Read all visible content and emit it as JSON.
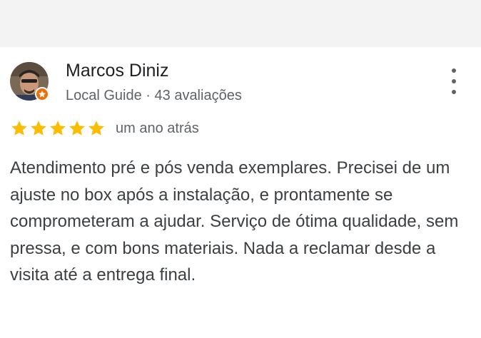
{
  "review": {
    "author": "Marcos Diniz",
    "author_meta": "Local Guide · 43 avaliações",
    "rating": 5,
    "rating_max": 5,
    "date": "um ano atrás",
    "text": "Atendimento pré e pós venda exemplares. Precisei de um ajuste no box após a instalação, e prontamente se comprometeram a ajudar. Serviço de ótima qualidade, sem pressa, e com bons materiais. Nada a reclamar desde a visita até a entrega final."
  },
  "icons": {
    "more": "more-vert-icon",
    "badge": "local-guide-star-icon",
    "star": "star-icon"
  },
  "colors": {
    "star": "#fbbc04",
    "badge": "#e8710a",
    "name": "#202124",
    "secondary": "#5f6368",
    "body_text": "#3c4043"
  }
}
